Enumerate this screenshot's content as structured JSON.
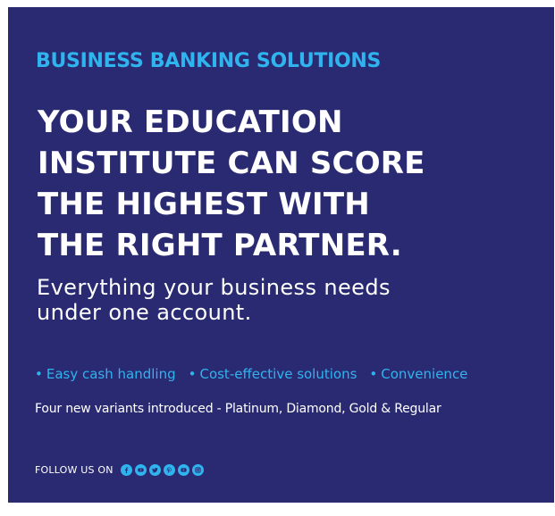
{
  "ad": {
    "eyebrow": "BUSINESS BANKING SOLUTIONS",
    "headline_lines": [
      "YOUR EDUCATION",
      "INSTITUTE CAN SCORE",
      "THE HIGHEST WITH",
      "THE RIGHT PARTNER."
    ],
    "subhead_lines": [
      "Everything your business needs",
      "under one account."
    ],
    "features": [
      "Easy cash handling",
      "Cost-effective solutions",
      "Convenience"
    ],
    "variants_text": "Four new variants introduced - Platinum, Diamond, Gold & Regular",
    "follow_label": "FOLLOW US ON",
    "social_icons": [
      "facebook-icon",
      "youtube-icon",
      "twitter-icon",
      "pinterest-icon",
      "video-icon",
      "instagram-icon"
    ]
  },
  "colors": {
    "background": "#2a2a73",
    "accent": "#2fb4ee",
    "text": "#ffffff"
  }
}
